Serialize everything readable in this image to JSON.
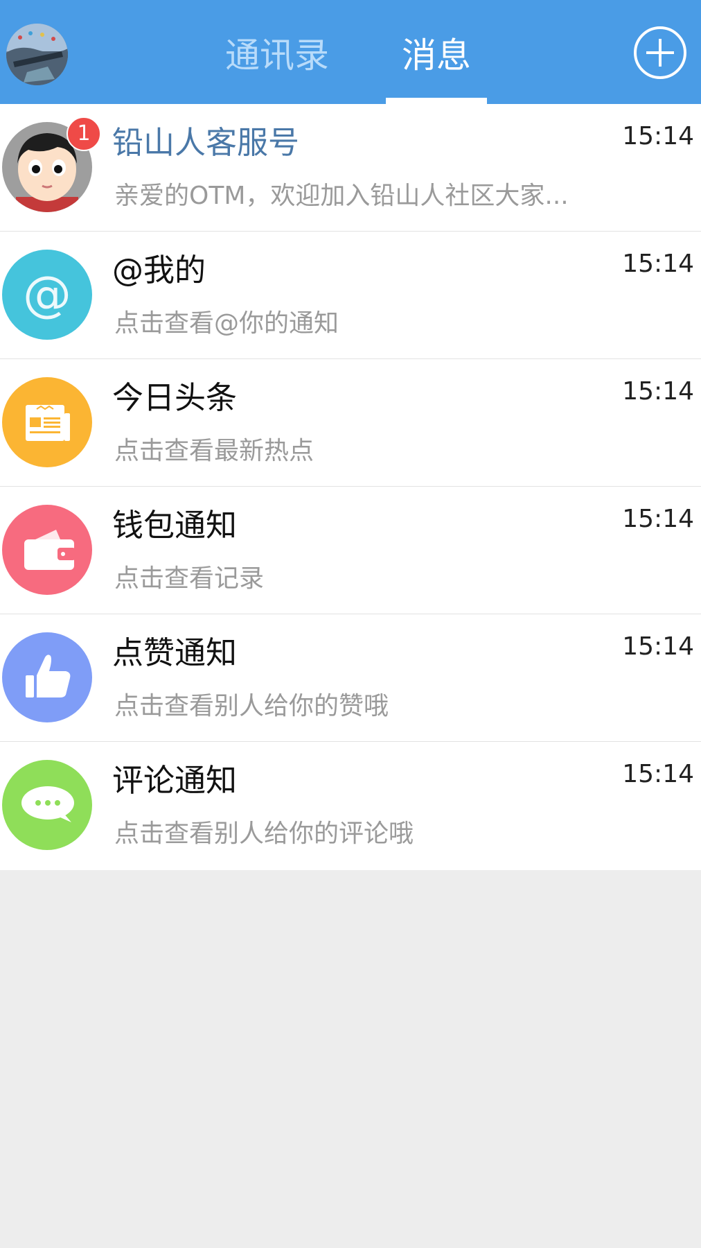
{
  "header": {
    "tabs": [
      {
        "label": "通讯录",
        "active": false
      },
      {
        "label": "消息",
        "active": true
      }
    ],
    "avatar_icon": "user-avatar-icon",
    "add_icon": "plus-circle-icon",
    "colors": {
      "bar": "#4a9ce6",
      "active_tab": "#ffffff",
      "inactive_tab": "#b8dbfa"
    }
  },
  "messages": [
    {
      "title": "铅山人客服号",
      "subtitle": "亲爱的OTM，欢迎加入铅山人社区大家...",
      "time": "15:14",
      "badge": "1",
      "icon": "customer-service-avatar-icon",
      "color": "#9e9e9e"
    },
    {
      "title": "@我的",
      "subtitle": "点击查看@你的通知",
      "time": "15:14",
      "icon": "at-icon",
      "color": "#45c4dc"
    },
    {
      "title": "今日头条",
      "subtitle": "点击查看最新热点",
      "time": "15:14",
      "icon": "newspaper-icon",
      "color": "#fbb533"
    },
    {
      "title": "钱包通知",
      "subtitle": "点击查看记录",
      "time": "15:14",
      "icon": "wallet-icon",
      "color": "#f76b7f"
    },
    {
      "title": "点赞通知",
      "subtitle": "点击查看别人给你的赞哦",
      "time": "15:14",
      "icon": "thumbs-up-icon",
      "color": "#7f9df7"
    },
    {
      "title": "评论通知",
      "subtitle": "点击查看别人给你的评论哦",
      "time": "15:14",
      "icon": "comment-icon",
      "color": "#8fde59"
    }
  ]
}
